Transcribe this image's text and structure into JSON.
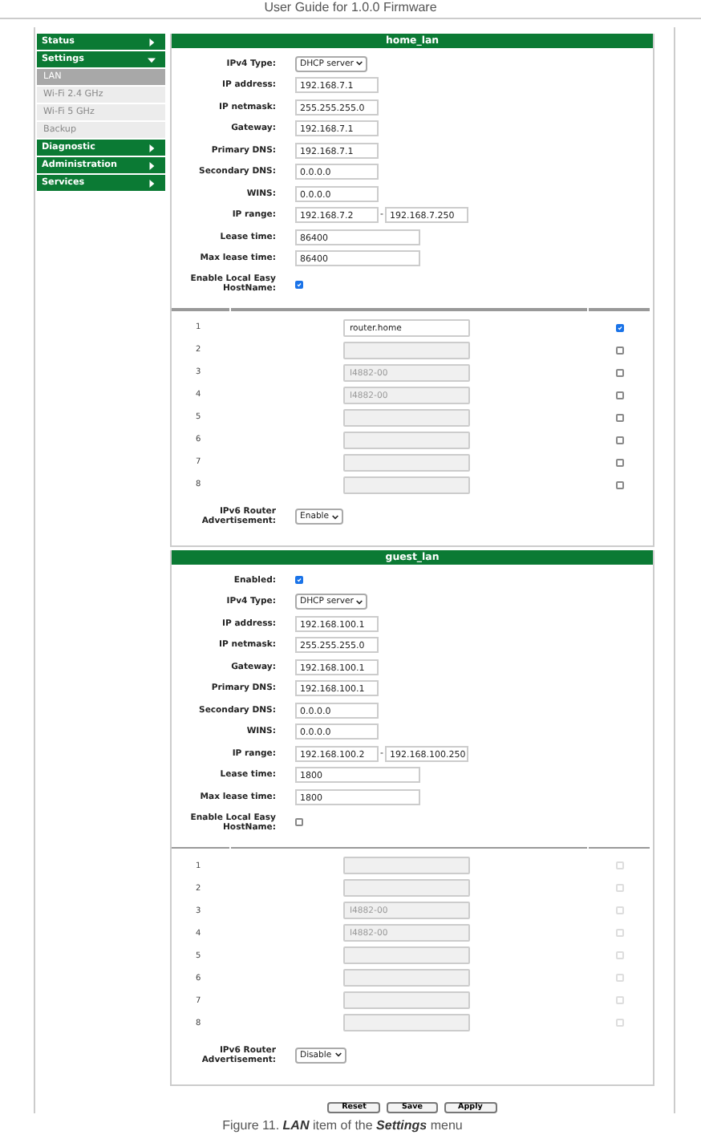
{
  "page_header": "User Guide for 1.0.0 Firmware",
  "sidebar": [
    {
      "label": "Status",
      "expanded": false
    },
    {
      "label": "Settings",
      "expanded": true,
      "children": [
        {
          "label": "LAN",
          "selected": true
        },
        {
          "label": "Wi-Fi 2.4 GHz",
          "selected": false
        },
        {
          "label": "Wi-Fi 5 GHz",
          "selected": false
        },
        {
          "label": "Backup",
          "selected": false
        }
      ]
    },
    {
      "label": "Diagnostic",
      "expanded": false
    },
    {
      "label": "Administration",
      "expanded": false
    },
    {
      "label": "Services",
      "expanded": false
    }
  ],
  "sections": [
    {
      "title": "home_lan",
      "fields": [
        {
          "kind": "select",
          "label": "IPv4 Type:",
          "value": "DHCP server"
        },
        {
          "kind": "text",
          "label": "IP address:",
          "value": "192.168.7.1"
        },
        {
          "kind": "text",
          "label": "IP netmask:",
          "value": "255.255.255.0"
        },
        {
          "kind": "text",
          "label": "Gateway:",
          "value": "192.168.7.1"
        },
        {
          "kind": "text",
          "label": "Primary DNS:",
          "value": "192.168.7.1"
        },
        {
          "kind": "text",
          "label": "Secondary DNS:",
          "value": "0.0.0.0"
        },
        {
          "kind": "text",
          "label": "WINS:",
          "value": "0.0.0.0"
        },
        {
          "kind": "range",
          "label": "IP range:",
          "value": "192.168.7.2",
          "separator": "-",
          "value_end": "192.168.7.250"
        },
        {
          "kind": "wide",
          "label": "Lease time:",
          "value": "86400"
        },
        {
          "kind": "wide",
          "label": "Max lease time:",
          "value": "86400"
        }
      ],
      "local_hostname": {
        "label": "Enable Local Easy HostName:",
        "checked": true
      },
      "hosts": [
        {
          "number": "1",
          "value": "router.home",
          "disabled": false,
          "checked": true
        },
        {
          "number": "2",
          "disabled": true,
          "checked": false
        },
        {
          "number": "3",
          "placeholder": "I4882-00",
          "disabled": true,
          "checked": false
        },
        {
          "number": "4",
          "placeholder": "I4882-00",
          "disabled": true,
          "checked": false
        },
        {
          "number": "5",
          "disabled": true,
          "checked": false
        },
        {
          "number": "6",
          "disabled": true,
          "checked": false
        },
        {
          "number": "7",
          "disabled": true,
          "checked": false
        },
        {
          "number": "8",
          "disabled": true,
          "checked": false
        }
      ],
      "ipv6": {
        "label": "IPv6 Router Advertisement:",
        "value": "Enable"
      }
    },
    {
      "title": "guest_lan",
      "fields": [
        {
          "kind": "checkbox",
          "label": "Enabled:",
          "checked": true
        },
        {
          "kind": "select",
          "label": "IPv4 Type:",
          "value": "DHCP server"
        },
        {
          "kind": "text",
          "label": "IP address:",
          "value": "192.168.100.1"
        },
        {
          "kind": "text",
          "label": "IP netmask:",
          "value": "255.255.255.0"
        },
        {
          "kind": "text",
          "label": "Gateway:",
          "value": "192.168.100.1"
        },
        {
          "kind": "text",
          "label": "Primary DNS:",
          "value": "192.168.100.1"
        },
        {
          "kind": "text",
          "label": "Secondary DNS:",
          "value": "0.0.0.0"
        },
        {
          "kind": "text",
          "label": "WINS:",
          "value": "0.0.0.0"
        },
        {
          "kind": "range",
          "label": "IP range:",
          "value": "192.168.100.2",
          "separator": "-",
          "value_end": "192.168.100.250"
        },
        {
          "kind": "wide",
          "label": "Lease time:",
          "value": "1800"
        },
        {
          "kind": "wide",
          "label": "Max lease time:",
          "value": "1800"
        }
      ],
      "local_hostname": {
        "label": "Enable Local Easy HostName:",
        "checked": false
      },
      "hosts": [
        {
          "number": "1",
          "disabled": true,
          "checked": false
        },
        {
          "number": "2",
          "disabled": true,
          "checked": false
        },
        {
          "number": "3",
          "placeholder": "I4882-00",
          "disabled": true,
          "checked": false
        },
        {
          "number": "4",
          "placeholder": "I4882-00",
          "disabled": true,
          "checked": false
        },
        {
          "number": "5",
          "disabled": true,
          "checked": false
        },
        {
          "number": "6",
          "disabled": true,
          "checked": false
        },
        {
          "number": "7",
          "disabled": true,
          "checked": false
        },
        {
          "number": "8",
          "disabled": true,
          "checked": false
        }
      ],
      "ipv6": {
        "label": "IPv6 Router Advertisement:",
        "value": "Disable"
      }
    }
  ],
  "buttons": [
    "Reset",
    "Save",
    "Apply"
  ],
  "caption": "Figure 11. **LAN** item of the **Settings** menu"
}
